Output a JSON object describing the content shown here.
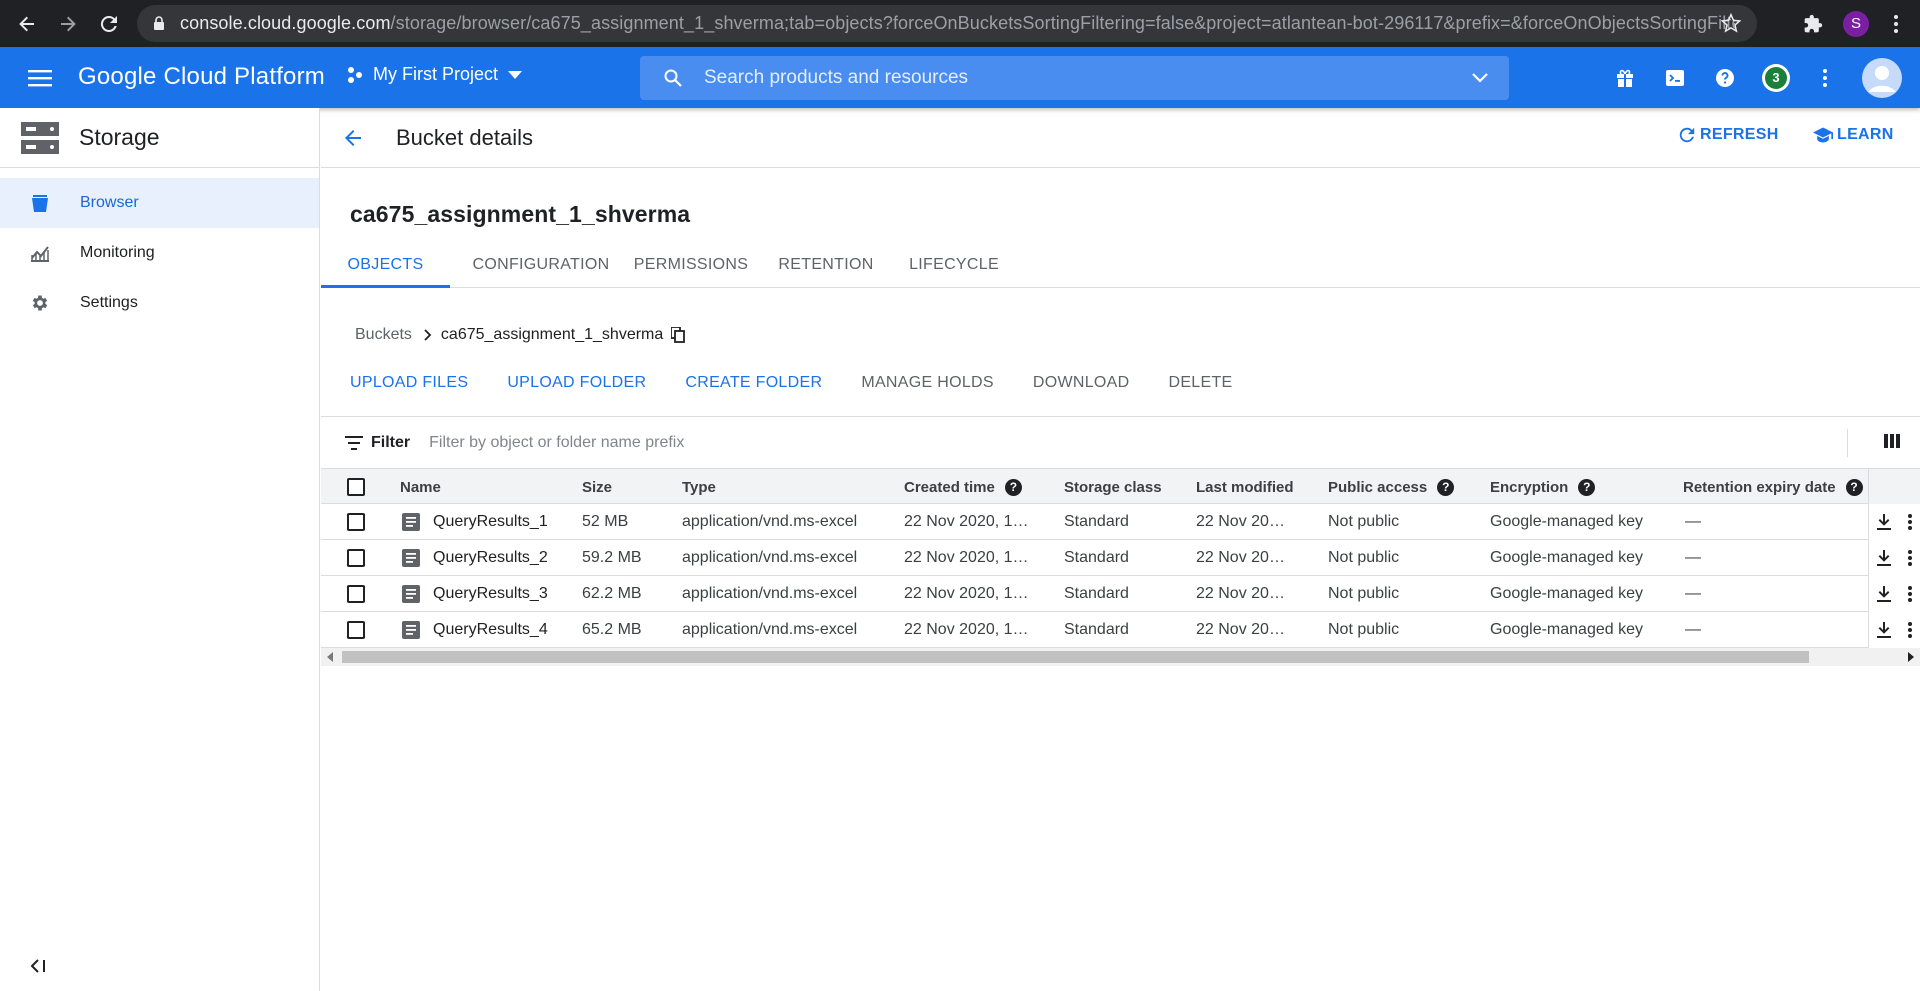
{
  "browser": {
    "url_host": "console.cloud.google.com",
    "url_path": "/storage/browser/ca675_assignment_1_shverma;tab=objects?forceOnBucketsSortingFiltering=false&project=atlantean-bot-296117&prefix=&forceOnObjectsSortingFiltering...",
    "profile_initial": "S"
  },
  "header": {
    "app_title": "Google Cloud Platform",
    "project": "My First Project",
    "search_placeholder": "Search products and resources",
    "notification_count": "3"
  },
  "sidebar": {
    "title": "Storage",
    "items": [
      {
        "label": "Browser",
        "icon": "bucket-icon",
        "active": true
      },
      {
        "label": "Monitoring",
        "icon": "chart-icon",
        "active": false
      },
      {
        "label": "Settings",
        "icon": "gear-icon",
        "active": false
      }
    ]
  },
  "page": {
    "title": "Bucket details",
    "refresh": "REFRESH",
    "learn": "LEARN",
    "bucket_name": "ca675_assignment_1_shverma",
    "tabs": [
      {
        "label": "OBJECTS",
        "active": true
      },
      {
        "label": "CONFIGURATION",
        "active": false
      },
      {
        "label": "PERMISSIONS",
        "active": false
      },
      {
        "label": "RETENTION",
        "active": false
      },
      {
        "label": "LIFECYCLE",
        "active": false
      }
    ],
    "breadcrumb": [
      "Buckets",
      "ca675_assignment_1_shverma"
    ],
    "actions": [
      {
        "label": "UPLOAD FILES",
        "enabled": true
      },
      {
        "label": "UPLOAD FOLDER",
        "enabled": true
      },
      {
        "label": "CREATE FOLDER",
        "enabled": true
      },
      {
        "label": "MANAGE HOLDS",
        "enabled": false
      },
      {
        "label": "DOWNLOAD",
        "enabled": false
      },
      {
        "label": "DELETE",
        "enabled": false
      }
    ],
    "filter_label": "Filter",
    "filter_placeholder": "Filter by object or folder name prefix"
  },
  "table": {
    "columns": [
      "Name",
      "Size",
      "Type",
      "Created time",
      "Storage class",
      "Last modified",
      "Public access",
      "Encryption",
      "Retention expiry date"
    ],
    "rows": [
      {
        "name": "QueryResults_1",
        "size": "52 MB",
        "type": "application/vnd.ms-excel",
        "created": "22 Nov 2020, 1…",
        "storage_class": "Standard",
        "modified": "22 Nov 20…",
        "public": "Not public",
        "encryption": "Google-managed key",
        "retention": "—"
      },
      {
        "name": "QueryResults_2",
        "size": "59.2 MB",
        "type": "application/vnd.ms-excel",
        "created": "22 Nov 2020, 1…",
        "storage_class": "Standard",
        "modified": "22 Nov 20…",
        "public": "Not public",
        "encryption": "Google-managed key",
        "retention": "—"
      },
      {
        "name": "QueryResults_3",
        "size": "62.2 MB",
        "type": "application/vnd.ms-excel",
        "created": "22 Nov 2020, 1…",
        "storage_class": "Standard",
        "modified": "22 Nov 20…",
        "public": "Not public",
        "encryption": "Google-managed key",
        "retention": "—"
      },
      {
        "name": "QueryResults_4",
        "size": "65.2 MB",
        "type": "application/vnd.ms-excel",
        "created": "22 Nov 2020, 1…",
        "storage_class": "Standard",
        "modified": "22 Nov 20…",
        "public": "Not public",
        "encryption": "Google-managed key",
        "retention": "—"
      }
    ]
  },
  "colors": {
    "brand_blue": "#1a73e8",
    "browser_dark": "#202124",
    "active_nav_bg": "#e8f0fe"
  }
}
